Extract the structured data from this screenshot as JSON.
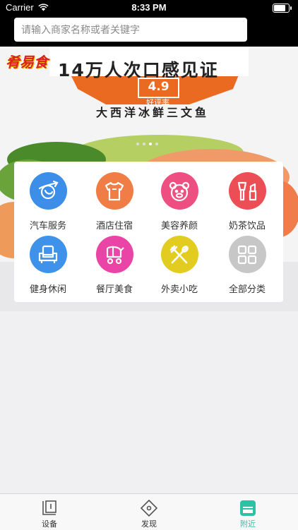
{
  "status": {
    "carrier": "Carrier",
    "time": "8:33 PM",
    "battery_level": 0.9
  },
  "search": {
    "placeholder": "请输入商家名称或者关键字"
  },
  "banner": {
    "logo_text": "肴易食",
    "headline": "14万人次口感见证",
    "rating": "4.9",
    "rating_label": "好评率",
    "subtitle": "大西洋冰鲜三文鱼",
    "slide_count": 4,
    "active_slide": 3
  },
  "categories": [
    {
      "label": "汽车服务",
      "icon": "car-service-icon",
      "color": "#3c8ee9"
    },
    {
      "label": "酒店住宿",
      "icon": "hotel-shirt-icon",
      "color": "#ef7d45"
    },
    {
      "label": "美容养颜",
      "icon": "beauty-bear-icon",
      "color": "#ee4f83"
    },
    {
      "label": "奶茶饮品",
      "icon": "makeup-brush-icon",
      "color": "#ec4e55"
    },
    {
      "label": "健身休闲",
      "icon": "fitness-sofa-icon",
      "color": "#3e92ea"
    },
    {
      "label": "餐厅美食",
      "icon": "stroller-icon",
      "color": "#ea44a6"
    },
    {
      "label": "外卖小吃",
      "icon": "utensils-icon",
      "color": "#e2cc20"
    },
    {
      "label": "全部分类",
      "icon": "grid-icon",
      "color": "#c7c7c7"
    }
  ],
  "tabs": [
    {
      "label": "设备",
      "icon": "device-icon",
      "active": false
    },
    {
      "label": "发现",
      "icon": "discover-icon",
      "active": false
    },
    {
      "label": "附近",
      "icon": "nearby-icon",
      "active": true
    }
  ],
  "colors": {
    "active_tab": "#2cc3a5",
    "inactive_tab": "#555555"
  }
}
